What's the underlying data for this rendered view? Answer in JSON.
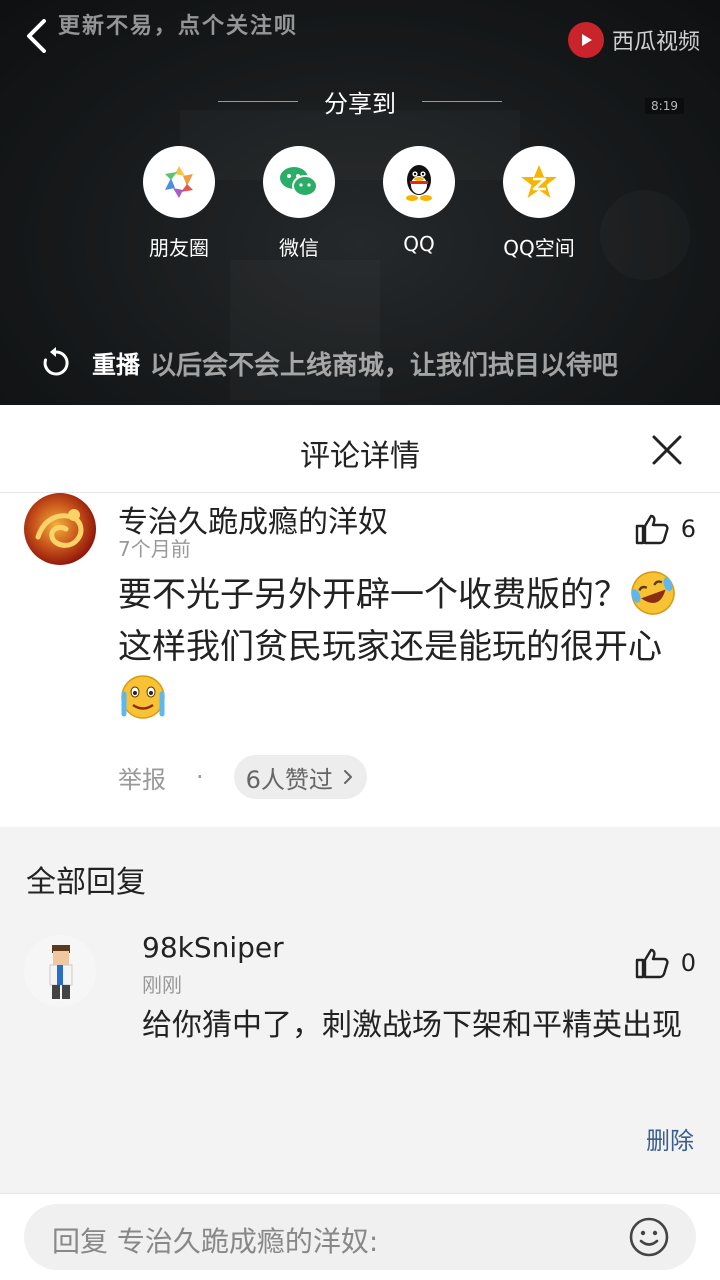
{
  "video": {
    "title": "更新不易，点个关注呗",
    "brand": "西瓜视频",
    "time_label": "8:19",
    "subtitle": "以后会不会上线商城，让我们拭目以待吧",
    "replay_label": "重播"
  },
  "share": {
    "title": "分享到",
    "items": [
      {
        "label": "朋友圈",
        "icon": "moments-icon"
      },
      {
        "label": "微信",
        "icon": "wechat-icon"
      },
      {
        "label": "QQ",
        "icon": "qq-icon"
      },
      {
        "label": "QQ空间",
        "icon": "qzone-icon"
      }
    ]
  },
  "panel": {
    "title": "评论详情"
  },
  "comment": {
    "username": "专治久跪成瘾的洋奴",
    "time": "7个月前",
    "like_count": "6",
    "text_line1": "要不光子另外开辟一个收费版的？",
    "text_line2": "这样我们贫民玩家还是能玩的很开心",
    "report": "举报",
    "separator": "·",
    "likers": "6人赞过"
  },
  "replies": {
    "title": "全部回复",
    "items": [
      {
        "username": "98kSniper",
        "time": "刚刚",
        "like_count": "0",
        "text": "给你猜中了，刺激战场下架和平精英出现",
        "delete_label": "删除"
      }
    ]
  },
  "reply_box": {
    "placeholder": "回复 专治久跪成瘾的洋奴:"
  },
  "colors": {
    "link": "#3a5f8f",
    "brand_red": "#c9242b",
    "muted": "#999999"
  }
}
